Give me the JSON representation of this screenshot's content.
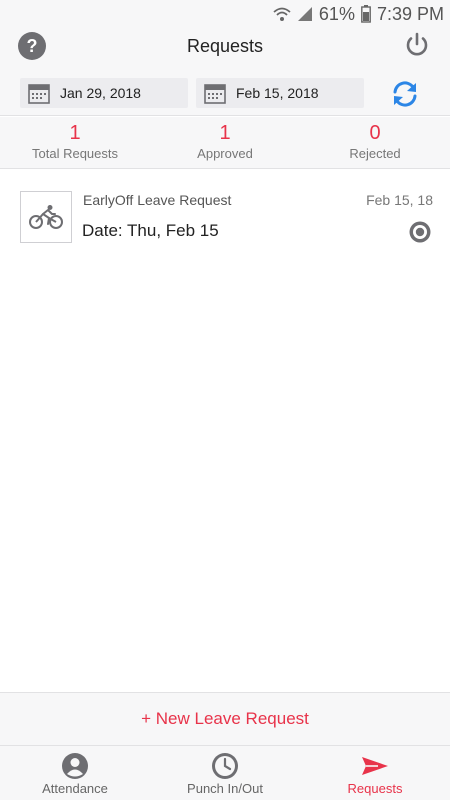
{
  "status_bar": {
    "battery_percent": "61%",
    "time": "7:39 PM",
    "icons": [
      "wifi-icon",
      "signal-icon",
      "battery-icon"
    ]
  },
  "header": {
    "title": "Requests",
    "left_icon": "help-icon",
    "right_icon": "power-icon"
  },
  "date_range": {
    "from": "Jan 29, 2018",
    "to": "Feb 15, 2018",
    "refresh_icon": "refresh-icon"
  },
  "stats": {
    "total_value": "1",
    "total_label": "Total Requests",
    "approved_value": "1",
    "approved_label": "Approved",
    "rejected_value": "0",
    "rejected_label": "Rejected"
  },
  "requests": [
    {
      "icon": "bicycle-icon",
      "type": "EarlyOff Leave Request",
      "short_date": "Feb 15, 18",
      "detail": "Date: Thu, Feb 15",
      "status_icon": "status-pending-icon"
    }
  ],
  "new_request": {
    "label": "+ New Leave Request"
  },
  "tabs": [
    {
      "label": "Attendance",
      "icon": "person-icon",
      "active": false
    },
    {
      "label": "Punch In/Out",
      "icon": "clock-icon",
      "active": false
    },
    {
      "label": "Requests",
      "icon": "send-icon",
      "active": true
    }
  ],
  "colors": {
    "accent": "#e8334a",
    "refresh": "#2c86e6",
    "bar_background": "#f7f7f8",
    "icon_gray": "#6e6e72"
  }
}
